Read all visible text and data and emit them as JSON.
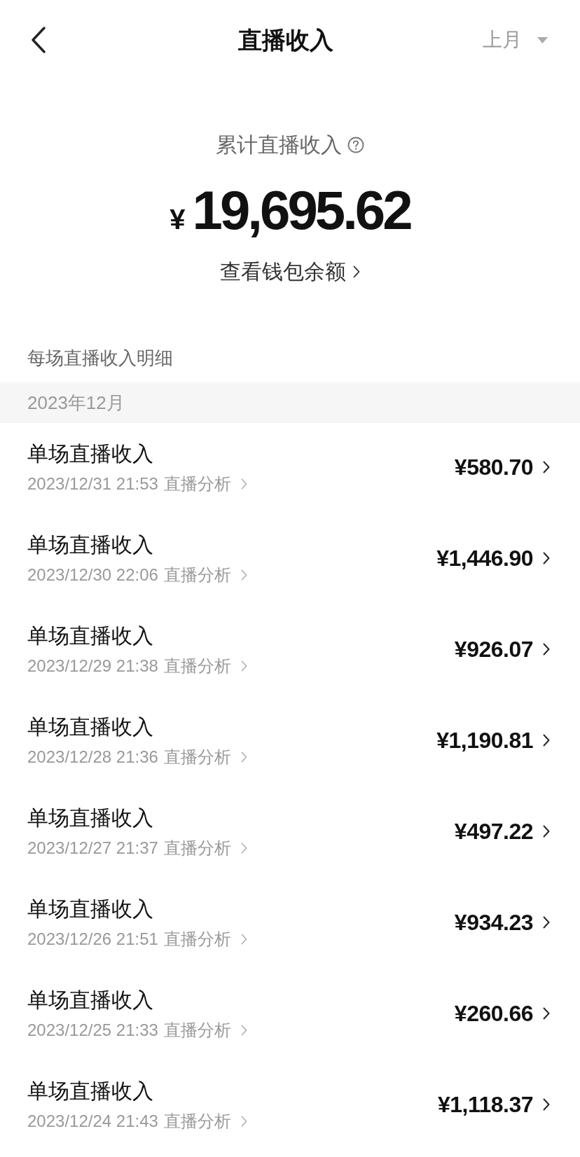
{
  "header": {
    "title": "直播收入",
    "period_filter": "上月"
  },
  "summary": {
    "label": "累计直播收入",
    "currency": "¥",
    "amount": "19,695.62",
    "wallet_link": "查看钱包余额"
  },
  "detail_heading": "每场直播收入明细",
  "month_groups": [
    {
      "month": "2023年12月",
      "rows": [
        {
          "title": "单场直播收入",
          "datetime": "2023/12/31 21:53",
          "analysis_link": "直播分析",
          "amount": "¥580.70"
        },
        {
          "title": "单场直播收入",
          "datetime": "2023/12/30 22:06",
          "analysis_link": "直播分析",
          "amount": "¥1,446.90"
        },
        {
          "title": "单场直播收入",
          "datetime": "2023/12/29 21:38",
          "analysis_link": "直播分析",
          "amount": "¥926.07"
        },
        {
          "title": "单场直播收入",
          "datetime": "2023/12/28 21:36",
          "analysis_link": "直播分析",
          "amount": "¥1,190.81"
        },
        {
          "title": "单场直播收入",
          "datetime": "2023/12/27 21:37",
          "analysis_link": "直播分析",
          "amount": "¥497.22"
        },
        {
          "title": "单场直播收入",
          "datetime": "2023/12/26 21:51",
          "analysis_link": "直播分析",
          "amount": "¥934.23"
        },
        {
          "title": "单场直播收入",
          "datetime": "2023/12/25 21:33",
          "analysis_link": "直播分析",
          "amount": "¥260.66"
        },
        {
          "title": "单场直播收入",
          "datetime": "2023/12/24 21:43",
          "analysis_link": "直播分析",
          "amount": "¥1,118.37"
        }
      ]
    }
  ]
}
